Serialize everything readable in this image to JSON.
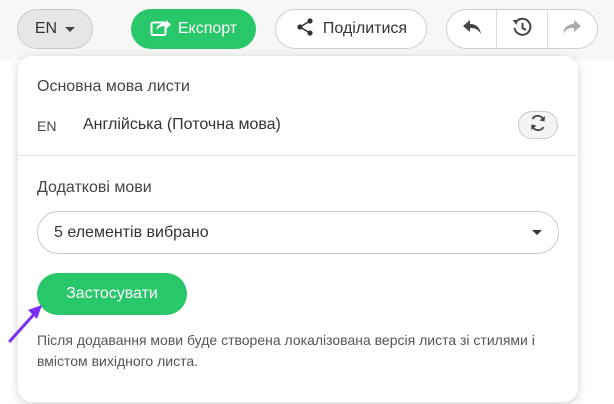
{
  "toolbar": {
    "language_button": {
      "label": "EN"
    },
    "export_button": {
      "label": "Експорт"
    },
    "share_button": {
      "label": "Поділитися"
    },
    "history": [
      "undo-icon",
      "history-icon",
      "redo-icon"
    ]
  },
  "panel": {
    "primary_section": {
      "title": "Основна мова листи",
      "code": "EN",
      "language": "Англійська (Поточна мова)"
    },
    "additional_section": {
      "title": "Додаткові мови",
      "select_value": "5 елементів вибрано"
    },
    "apply_button": {
      "label": "Застосувати"
    },
    "note": "Після додавання мови буде створена локалізована версія листа зі стилями і вмістом вихідного листа."
  },
  "colors": {
    "accent": "#28c76a",
    "pointer_arrow": "#7b2ff7"
  }
}
